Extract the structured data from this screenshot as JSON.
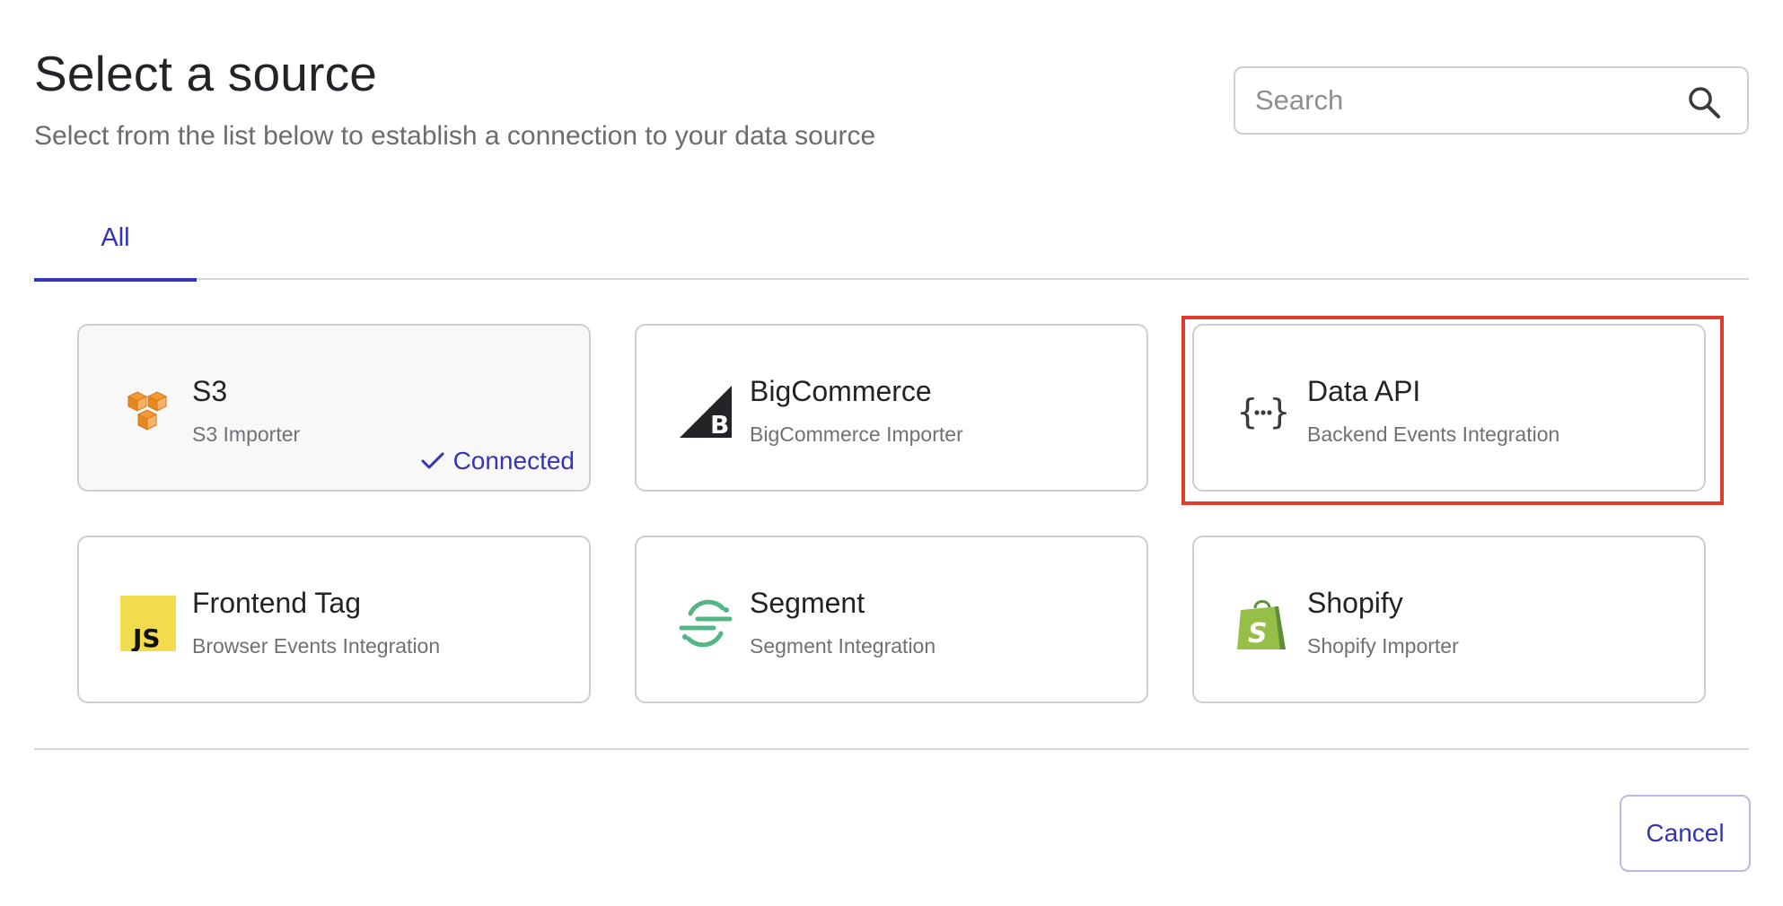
{
  "header": {
    "title": "Select a source",
    "subtitle": "Select from the list below to establish a connection to your data source"
  },
  "search": {
    "placeholder": "Search",
    "value": "",
    "icon": "search-icon"
  },
  "tabs": [
    {
      "label": "All",
      "active": true
    }
  ],
  "sources": [
    {
      "name": "S3",
      "description": "S3 Importer",
      "icon": "aws-s3-icon",
      "status": "Connected",
      "connected": true
    },
    {
      "name": "BigCommerce",
      "description": "BigCommerce Importer",
      "icon": "bigcommerce-icon"
    },
    {
      "name": "Data API",
      "description": "Backend Events Integration",
      "icon": "data-api-icon",
      "highlighted": true
    },
    {
      "name": "Frontend Tag",
      "description": "Browser Events Integration",
      "icon": "javascript-icon"
    },
    {
      "name": "Segment",
      "description": "Segment Integration",
      "icon": "segment-icon"
    },
    {
      "name": "Shopify",
      "description": "Shopify Importer",
      "icon": "shopify-icon"
    }
  ],
  "footer": {
    "cancel_label": "Cancel"
  },
  "colors": {
    "accent": "#3434b8",
    "highlight": "#e23b2a",
    "aws_orange": "#f49a35",
    "js_yellow": "#f2db4c",
    "segment_green": "#52b784",
    "shopify_green": "#95bf47"
  }
}
